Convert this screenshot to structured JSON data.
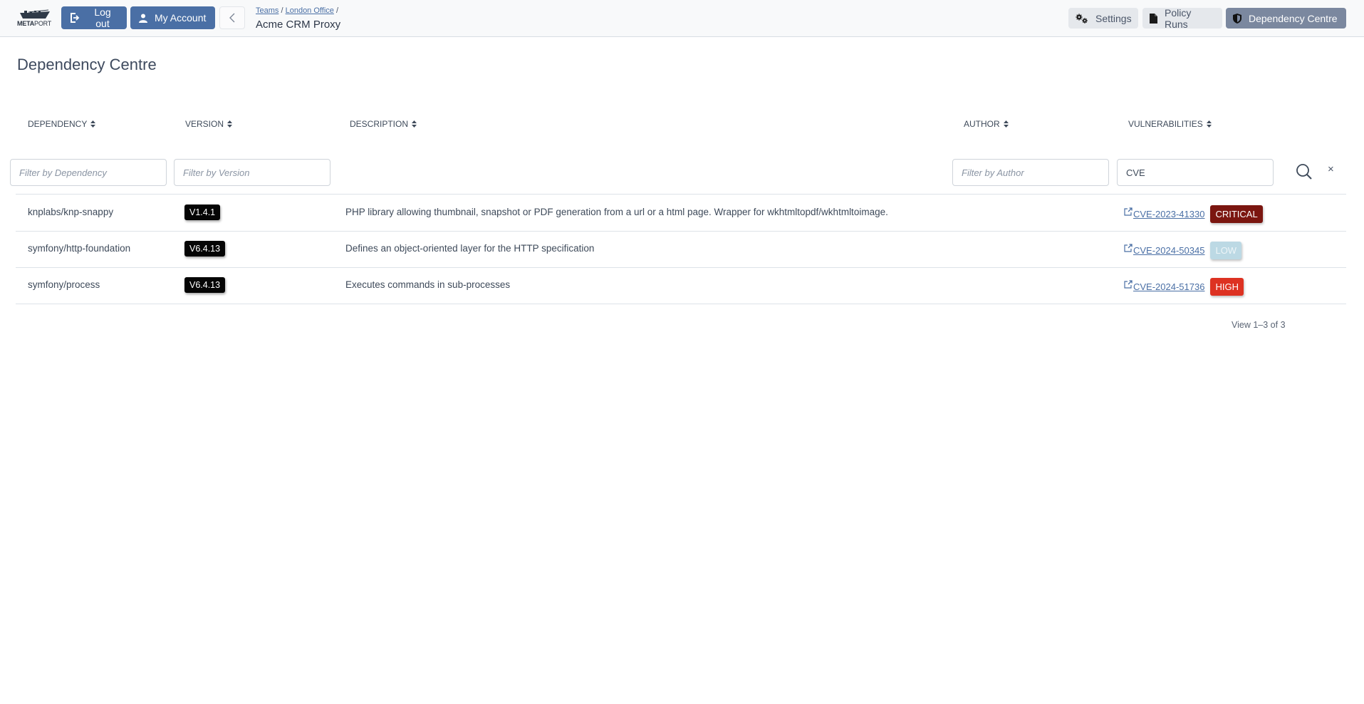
{
  "header": {
    "logo": {
      "text_bold": "META",
      "text_thin": "PORT"
    },
    "logout_label": "Log out",
    "account_label": "My Account",
    "breadcrumb": [
      {
        "label": "Teams"
      },
      {
        "label": "London Office"
      }
    ],
    "breadcrumb_separator": "/",
    "page_subtitle": "Acme CRM Proxy",
    "nav": {
      "settings": "Settings",
      "policy_runs": "Policy Runs",
      "dependency_centre": "Dependency Centre"
    }
  },
  "main": {
    "title": "Dependency Centre",
    "columns": {
      "dependency": "Dependency",
      "version": "Version",
      "description": "Description",
      "author": "Author",
      "vulnerabilities": "Vulnerabilities"
    },
    "filters": {
      "dependency": {
        "placeholder": "Filter by Dependency",
        "value": ""
      },
      "version": {
        "placeholder": "Filter by Version",
        "value": ""
      },
      "author": {
        "placeholder": "Filter by Author",
        "value": ""
      },
      "vulnerabilities": {
        "placeholder": "",
        "value": "CVE"
      }
    },
    "clear_label": "×",
    "rows": [
      {
        "dependency": "knplabs/knp-snappy",
        "version": "V1.4.1",
        "description": "PHP library allowing thumbnail, snapshot or PDF generation from a url or a html page. Wrapper for wkhtmltopdf/wkhtmltoimage.",
        "cve": "CVE-2023-41330",
        "severity": "CRITICAL",
        "severity_bg": "#7b1610",
        "severity_fg": "#ffffff"
      },
      {
        "dependency": "symfony/http-foundation",
        "version": "V6.4.13",
        "description": "Defines an object-oriented layer for the HTTP specification",
        "cve": "CVE-2024-50345",
        "severity": "LOW",
        "severity_bg": "#bcd9e4",
        "severity_fg": "#eef5f8"
      },
      {
        "dependency": "symfony/process",
        "version": "V6.4.13",
        "description": "Executes commands in sub-processes",
        "cve": "CVE-2024-51736",
        "severity": "HIGH",
        "severity_bg": "#dd3222",
        "severity_fg": "#ffffff"
      }
    ],
    "pager": "View 1–3 of 3"
  },
  "colors": {
    "primary": "#4a6fa5",
    "nav_active": "#7b889f",
    "nav_inactive": "#e5e8ec"
  }
}
